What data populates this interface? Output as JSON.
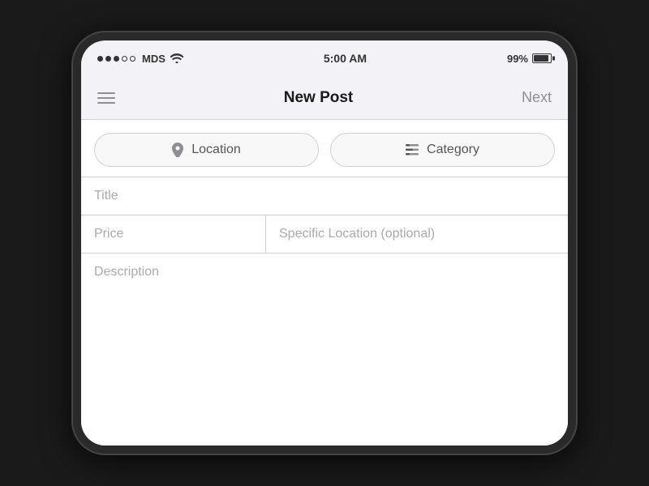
{
  "status_bar": {
    "signal_dots": [
      {
        "filled": true
      },
      {
        "filled": true
      },
      {
        "filled": true
      },
      {
        "filled": false
      },
      {
        "filled": false
      }
    ],
    "carrier": "MDS",
    "time": "5:00 AM",
    "battery_percent": "99%"
  },
  "nav_bar": {
    "title": "New Post",
    "next_label": "Next"
  },
  "filter_buttons": [
    {
      "icon": "📍",
      "label": "Location"
    },
    {
      "icon": "≡",
      "label": "Category"
    }
  ],
  "form": {
    "title_placeholder": "Title",
    "price_placeholder": "Price",
    "specific_location_placeholder": "Specific Location (optional)",
    "description_placeholder": "Description"
  }
}
